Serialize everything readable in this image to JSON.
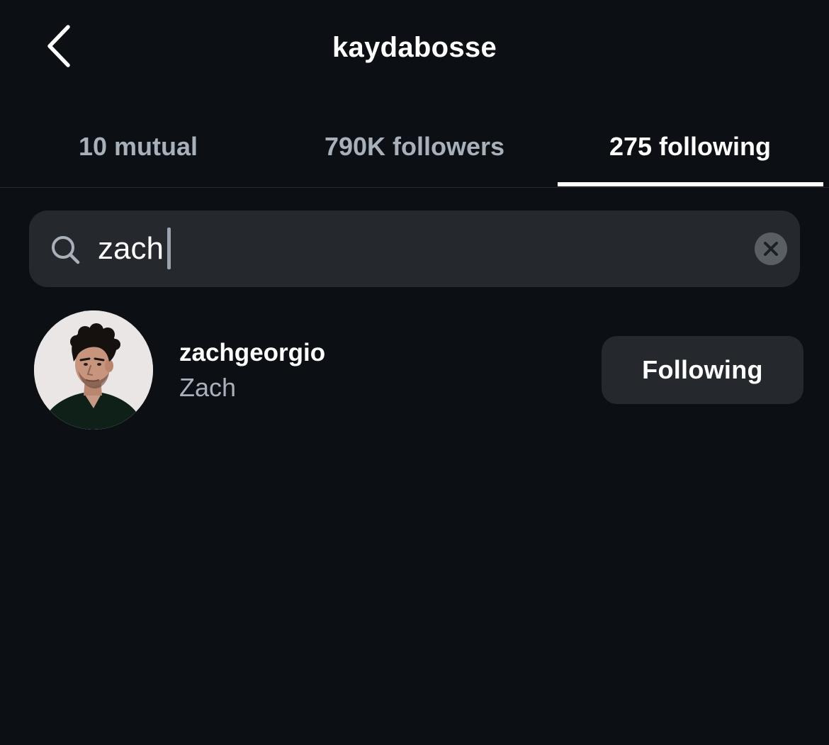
{
  "header": {
    "title": "kaydabosse",
    "back_icon": "chevron-left-icon"
  },
  "tabs": [
    {
      "label": "10 mutual",
      "active": false
    },
    {
      "label": "790K followers",
      "active": false
    },
    {
      "label": "275 following",
      "active": true
    }
  ],
  "search": {
    "value": "zach",
    "search_icon": "search-icon",
    "clear_icon": "close-icon"
  },
  "results": [
    {
      "username": "zachgeorgio",
      "full_name": "Zach",
      "button_label": "Following"
    }
  ],
  "colors": {
    "background": "#0c1014",
    "surface": "#25292e",
    "muted_text": "#a8b0ba",
    "primary_text": "#ffffff"
  }
}
